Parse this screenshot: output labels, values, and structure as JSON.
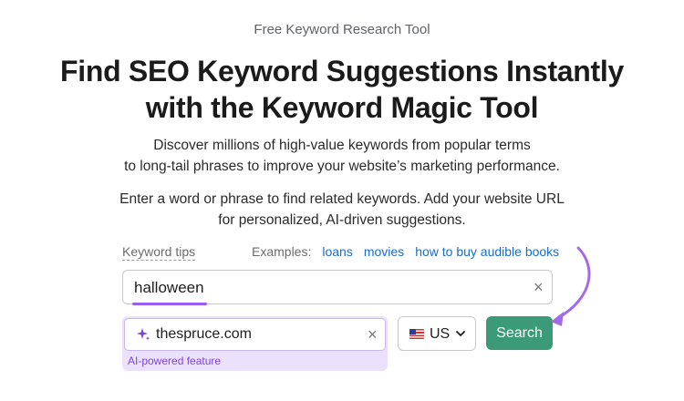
{
  "hero": {
    "eyebrow": "Free Keyword Research Tool",
    "title_line1": "Find SEO Keyword Suggestions Instantly",
    "title_line2": "with the Keyword Magic Tool",
    "desc_line1": "Discover millions of high-value keywords from popular terms",
    "desc_line2": "to long-tail phrases to improve your website’s marketing performance.",
    "instr_line1": "Enter a word or phrase to find related keywords. Add your website URL",
    "instr_line2": "for personalized, AI-driven suggestions."
  },
  "tips": {
    "label": "Keyword tips"
  },
  "examples": {
    "label": "Examples:",
    "items": [
      "loans",
      "movies",
      "how to buy audible books"
    ]
  },
  "keyword_input": {
    "value": "halloween",
    "clear_icon": "close-icon"
  },
  "website_input": {
    "value": "thespruce.com",
    "icon": "sparkle-icon",
    "clear_icon": "close-icon",
    "feature_label": "AI-powered feature"
  },
  "country_select": {
    "selected": "US",
    "flag_icon": "us-flag-icon"
  },
  "search_button": {
    "label": "Search"
  },
  "colors": {
    "accent": "#9a5cf3",
    "button": "#3b9a78",
    "link": "#1a6cc9"
  }
}
